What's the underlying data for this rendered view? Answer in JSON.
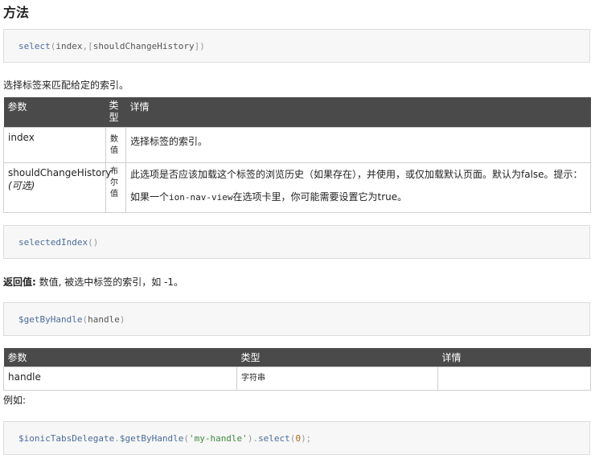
{
  "section_title": "方法",
  "select_sig": {
    "fn": "select",
    "open": "(",
    "arg1": "index",
    "sep": ", ",
    "opt_open": "[",
    "arg2": "shouldChangeHistory",
    "opt_close": "]",
    "close": ")"
  },
  "select_desc": "选择标签来匹配给定的索引。",
  "select_table": {
    "headers": {
      "param": "参数",
      "type": "类型",
      "detail": "详情"
    },
    "rows": [
      {
        "param": "index",
        "param_note": "",
        "type": "数值",
        "detail": "选择标签的索引。"
      },
      {
        "param": "shouldChangeHistory",
        "param_note": "(可选)",
        "type": "布尔值",
        "detail_a": "此选项是否应该加载这个标签的浏览历史（如果存在），并使用，或仅加载默认页面。默认为false。提示：",
        "detail_b": "如果一个",
        "detail_code": "ion-nav-view",
        "detail_c": "在选项卡里，你可能需要设置它为true。"
      }
    ]
  },
  "selected_index_sig": {
    "fn": "selectedIndex",
    "parens": "()"
  },
  "returns": {
    "label": "返回值:",
    "text": " 数值, 被选中标签的索引，如 -1。"
  },
  "gethandle_sig": {
    "fn": "$getByHandle",
    "open": "(",
    "arg": "handle",
    "close": ")"
  },
  "gethandle_table": {
    "headers": {
      "param": "参数",
      "type": "类型",
      "detail": "详情"
    },
    "rows": [
      {
        "param": "handle",
        "type": "字符串",
        "detail": ""
      }
    ]
  },
  "example_label": "例如:",
  "example_code": {
    "obj": "$ionicTabsDelegate",
    "dot1": ".",
    "fn1": "$getByHandle",
    "open1": "(",
    "str": "'my-handle'",
    "close1": ")",
    "dot2": ".",
    "fn2": "select",
    "open2": "(",
    "num": "0",
    "close2": ");"
  }
}
